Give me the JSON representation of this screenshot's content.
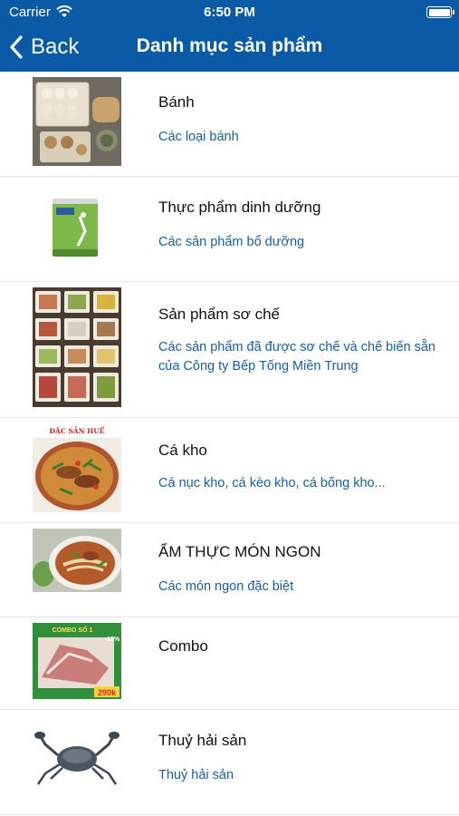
{
  "status_bar": {
    "carrier": "Carrier",
    "time": "6:50 PM"
  },
  "nav": {
    "back_label": "Back",
    "title": "Danh mục sản phẩm"
  },
  "categories": [
    {
      "title": "Bánh",
      "subtitle": "Các loại bánh",
      "image": "pastry-photo"
    },
    {
      "title": "Thực phẩm dinh dưỡng",
      "subtitle": "Các sản phẩm bổ dưỡng",
      "image": "milk-can-photo"
    },
    {
      "title": "Sản phẩm sơ chế",
      "subtitle": "Các sản phẩm đã được sơ chế và chế biến sẵn của Công ty Bếp Tống Miền Trung",
      "image": "prepared-food-trays-photo"
    },
    {
      "title": "Cá kho",
      "subtitle": "Cá nục kho, cá kèo kho, cá bống kho...",
      "image": "braised-fish-photo",
      "image_text": "ĐẶC SẢN HUẾ"
    },
    {
      "title": "ẨM THỰC MÓN NGON",
      "subtitle": "Các món ngon đặc biệt",
      "image": "noodle-soup-photo"
    },
    {
      "title": "Combo",
      "subtitle": "",
      "image": "combo-photo",
      "image_text": "COMBO SỐ 1",
      "badge": "-15%",
      "price": "290k"
    },
    {
      "title": "Thuỷ hải sản",
      "subtitle": "Thuỷ hải sản",
      "image": "crab-photo"
    }
  ],
  "colors": {
    "nav_bg": "#0b5aa6",
    "subtitle": "#1a5d9e",
    "divider": "#e3e3e3"
  }
}
